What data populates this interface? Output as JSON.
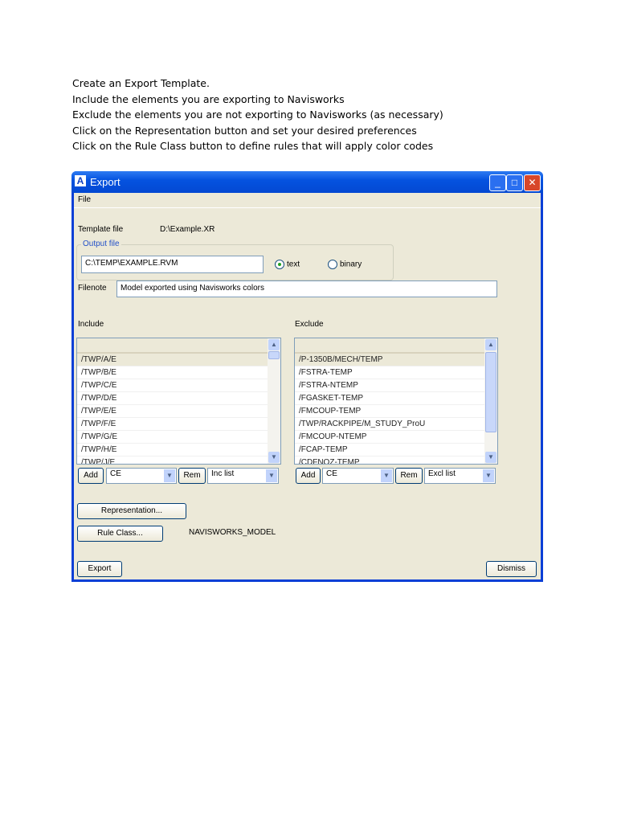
{
  "instructions": [
    "Create an Export Template.",
    "Include the elements you are exporting to Navisworks",
    "Exclude the elements you are not exporting to Navisworks (as necessary)",
    "Click on the Representation button and set your desired preferences",
    "Click on the Rule Class button to define rules that will apply color codes"
  ],
  "window": {
    "title": "Export",
    "menu": [
      "File"
    ]
  },
  "template": {
    "label": "Template file",
    "value": "D:\\Example.XR"
  },
  "output": {
    "group_label": "Output file",
    "value": "C:\\TEMP\\EXAMPLE.RVM",
    "radio_text": "text",
    "radio_binary": "binary",
    "selected": "text"
  },
  "filenote": {
    "label": "Filenote",
    "value": "Model exported using Navisworks colors"
  },
  "include": {
    "label": "Include",
    "items": [
      "/TWP/A/E",
      "/TWP/B/E",
      "/TWP/C/E",
      "/TWP/D/E",
      "/TWP/E/E",
      "/TWP/F/E",
      "/TWP/G/E",
      "/TWP/H/E",
      "/TWP/J/E"
    ],
    "add": "Add",
    "combo": "CE",
    "rem": "Rem",
    "list_combo": "Inc list"
  },
  "exclude": {
    "label": "Exclude",
    "items": [
      "/P-1350B/MECH/TEMP",
      "/FSTRA-TEMP",
      "/FSTRA-NTEMP",
      "/FGASKET-TEMP",
      "/FMCOUP-TEMP",
      "/TWP/RACKPIPE/M_STUDY_ProU",
      "/FMCOUP-NTEMP",
      "/FCAP-TEMP",
      "/CDFNOZ-TEMP"
    ],
    "add": "Add",
    "combo": "CE",
    "rem": "Rem",
    "list_combo": "Excl list"
  },
  "buttons": {
    "representation": "Representation...",
    "rule_class": "Rule Class...",
    "rule_class_value": "NAVISWORKS_MODEL",
    "export": "Export",
    "dismiss": "Dismiss"
  }
}
